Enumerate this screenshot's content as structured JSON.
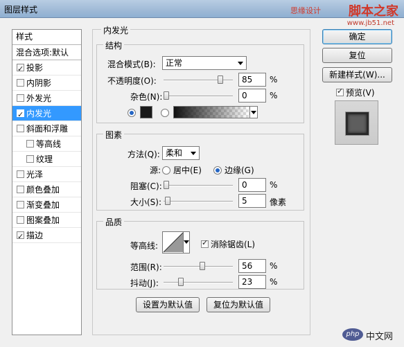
{
  "window": {
    "title": "图层样式",
    "watermark": "思缘设计",
    "brand": "脚本之家",
    "url": "www.jb51.net"
  },
  "sidebar": {
    "header": "样式",
    "blend_options": "混合选项:默认",
    "items": [
      {
        "label": "投影",
        "checked": true
      },
      {
        "label": "内阴影",
        "checked": false
      },
      {
        "label": "外发光",
        "checked": false
      },
      {
        "label": "内发光",
        "checked": true,
        "selected": true
      },
      {
        "label": "斜面和浮雕",
        "checked": false
      },
      {
        "label": "等高线",
        "checked": false,
        "indent": true
      },
      {
        "label": "纹理",
        "checked": false,
        "indent": true
      },
      {
        "label": "光泽",
        "checked": false
      },
      {
        "label": "颜色叠加",
        "checked": false
      },
      {
        "label": "渐变叠加",
        "checked": false
      },
      {
        "label": "图案叠加",
        "checked": false
      },
      {
        "label": "描边",
        "checked": true
      }
    ]
  },
  "panel": {
    "title": "内发光",
    "structure": {
      "title": "结构",
      "blend_mode_label": "混合模式(B):",
      "blend_mode_value": "正常",
      "opacity_label": "不透明度(O):",
      "opacity_value": "85",
      "opacity_fraction": 0.85,
      "noise_label": "杂色(N):",
      "noise_value": "0",
      "noise_fraction": 0,
      "percent": "%"
    },
    "elements": {
      "title": "图素",
      "method_label": "方法(Q):",
      "method_value": "柔和",
      "source_label": "源:",
      "source_center": "居中(E)",
      "source_edge": "边缘(G)",
      "choke_label": "阻塞(C):",
      "choke_value": "0",
      "choke_fraction": 0,
      "size_label": "大小(S):",
      "size_value": "5",
      "size_fraction": 0.02,
      "size_unit": "像素",
      "percent": "%"
    },
    "quality": {
      "title": "品质",
      "contour_label": "等高线:",
      "anti_alias_label": "消除锯齿(L)",
      "range_label": "范围(R):",
      "range_value": "56",
      "range_fraction": 0.56,
      "jitter_label": "抖动(J):",
      "jitter_value": "23",
      "jitter_fraction": 0.23,
      "percent": "%"
    },
    "make_default": "设置为默认值",
    "reset_default": "复位为默认值"
  },
  "right": {
    "ok": "确定",
    "reset": "复位",
    "new_style": "新建样式(W)...",
    "preview": "预览(V)"
  },
  "footer": {
    "php_badge": "php",
    "php_site": "中文网"
  },
  "colors": {
    "selected_bg": "#3399ff",
    "radio_dot": "#2566c4",
    "glow_swatch": "#1a1a1a"
  }
}
